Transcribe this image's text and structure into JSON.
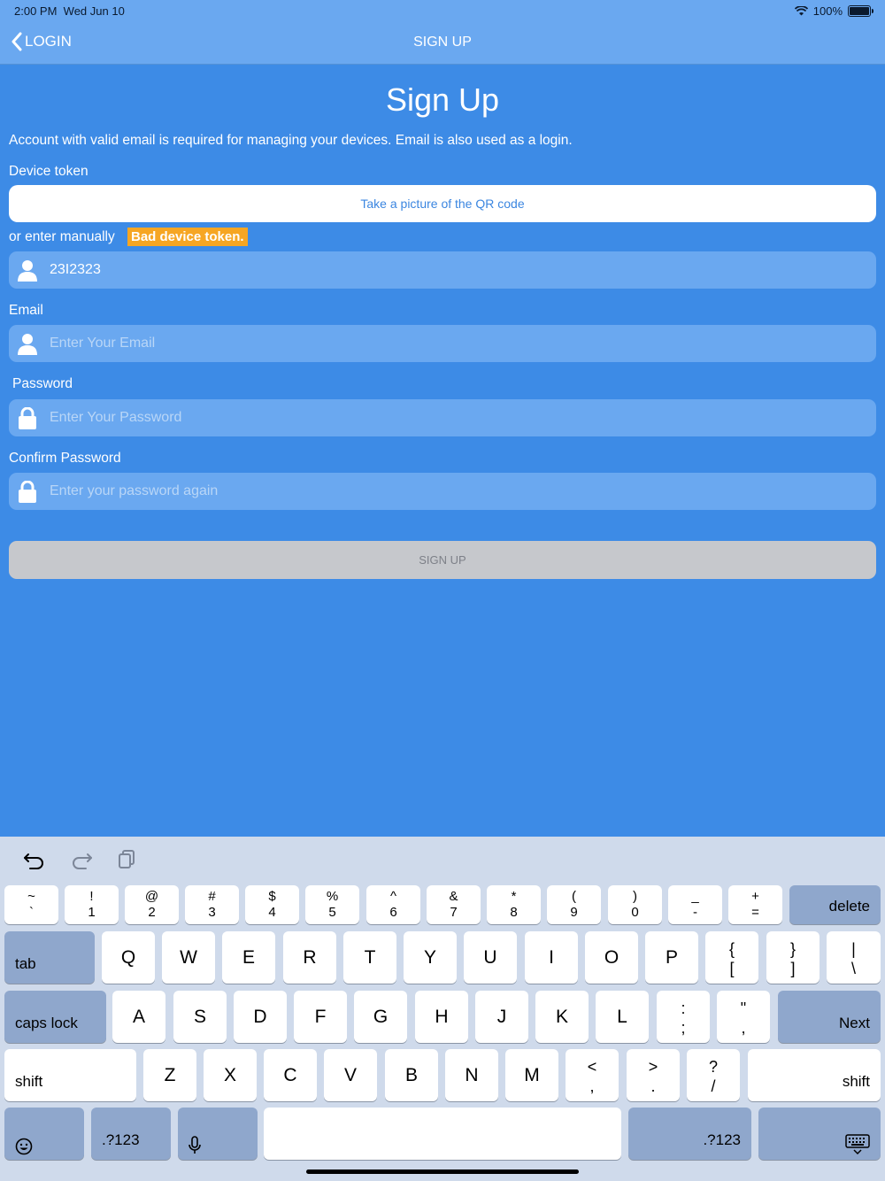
{
  "status": {
    "time": "2:00 PM",
    "date": "Wed Jun 10",
    "battery": "100%"
  },
  "nav": {
    "back_label": "LOGIN",
    "title": "SIGN UP"
  },
  "page": {
    "title": "Sign Up",
    "description": "Account with valid email is required for managing your devices. Email is also used as a login.",
    "device_token_label": "Device token",
    "qr_button": "Take a picture of the QR code",
    "manual_label": "or enter manually",
    "error_badge": "Bad device token.",
    "token_value": "23I2323",
    "email_label": "Email",
    "email_placeholder": "Enter Your Email",
    "password_label": "Password",
    "password_placeholder": "Enter Your Password",
    "confirm_label": "Confirm Password",
    "confirm_placeholder": "Enter your password again",
    "signup_button": "SIGN UP"
  },
  "keyboard": {
    "row1": [
      [
        "~",
        "`"
      ],
      [
        "!",
        "1"
      ],
      [
        "@",
        "2"
      ],
      [
        "#",
        "3"
      ],
      [
        "$",
        "4"
      ],
      [
        "%",
        "5"
      ],
      [
        "^",
        "6"
      ],
      [
        "&",
        "7"
      ],
      [
        "*",
        "8"
      ],
      [
        "(",
        "9"
      ],
      [
        ")",
        "0"
      ],
      [
        "_",
        "-"
      ],
      [
        "+",
        "="
      ]
    ],
    "delete": "delete",
    "tab": "tab",
    "row2": [
      "Q",
      "W",
      "E",
      "R",
      "T",
      "Y",
      "U",
      "I",
      "O",
      "P"
    ],
    "row2_extra": [
      [
        "{",
        "["
      ],
      [
        "}",
        "]"
      ],
      [
        "|",
        "\\"
      ]
    ],
    "caps": "caps lock",
    "row3": [
      "A",
      "S",
      "D",
      "F",
      "G",
      "H",
      "J",
      "K",
      "L"
    ],
    "row3_extra": [
      [
        ":",
        ";"
      ],
      [
        "\"",
        ","
      ]
    ],
    "next": "Next",
    "shift": "shift",
    "row4": [
      "Z",
      "X",
      "C",
      "V",
      "B",
      "N",
      "M"
    ],
    "row4_extra": [
      [
        "<",
        ","
      ],
      [
        ">",
        "."
      ],
      [
        "?",
        "/"
      ]
    ],
    "num": ".?123"
  }
}
